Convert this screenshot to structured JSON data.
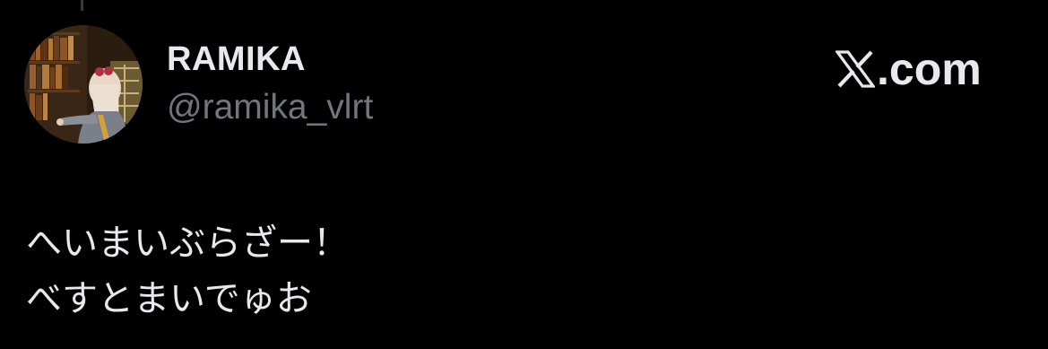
{
  "post": {
    "author": {
      "display_name": "RAMIKA",
      "handle": "@ramika_vlrt",
      "avatar_icon": "avatar-photo"
    },
    "brand": {
      "logo_icon": "x-logo-icon",
      "domain_suffix": ".com"
    },
    "text_lines": [
      "へいまいぶらざー！",
      "べすとまいでゅお"
    ]
  },
  "colors": {
    "background": "#000000",
    "primary_text": "#e7e9ea",
    "secondary_text": "#71767b"
  }
}
